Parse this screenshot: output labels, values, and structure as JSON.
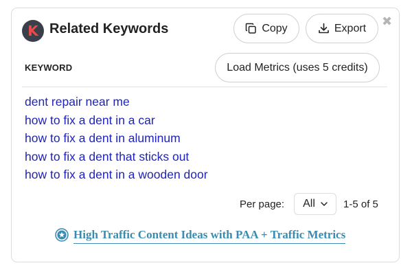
{
  "header": {
    "logo_letter": "K",
    "title": "Related Keywords",
    "copy_label": "Copy",
    "export_label": "Export",
    "close_symbol": "✖"
  },
  "table": {
    "column_header": "KEYWORD",
    "load_metrics_label": "Load Metrics (uses 5 credits)",
    "keywords": [
      "dent repair near me",
      "how to fix a dent in a car",
      "how to fix a dent in aluminum",
      "how to fix a dent that sticks out",
      "how to fix a dent in a wooden door"
    ]
  },
  "pagination": {
    "per_page_label": "Per page:",
    "per_page_value": "All",
    "range_text": "1-5 of 5"
  },
  "promo": {
    "link_text": "High Traffic Content Ideas with PAA + Traffic Metrics",
    "icon": "star-badge-icon"
  },
  "colors": {
    "keyword_link": "#1f23b8",
    "promo_link": "#3a8bb0",
    "logo_bg": "#3b3f4a",
    "logo_letter": "#ea4a4a"
  }
}
